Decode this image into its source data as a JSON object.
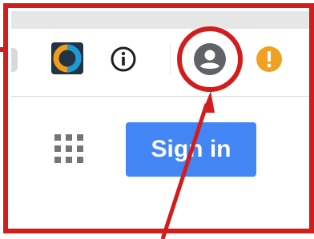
{
  "toolbar": {
    "extension_icon": "colorful-ring-extension-icon",
    "info_icon": "info-circle-icon",
    "info_glyph": "i",
    "profile_icon": "account-circle-icon",
    "alert_icon": "alert-exclamation-icon",
    "alert_glyph": "!"
  },
  "page": {
    "apps_icon": "apps-grid-icon",
    "sign_in_label": "Sign in"
  },
  "annotation": {
    "highlight": "circle-around-profile-icon",
    "pointer": "arrow-pointing-to-profile-icon"
  },
  "colors": {
    "annotation_red": "#d31c1c",
    "sign_in_blue": "#4285f4",
    "alert_orange": "#f0a11f",
    "profile_gray": "#5f6368",
    "ring_blue": "#1a9ad6",
    "ring_orange": "#f29c1b",
    "ext_bg": "#223344",
    "apps_gray": "#757575"
  }
}
